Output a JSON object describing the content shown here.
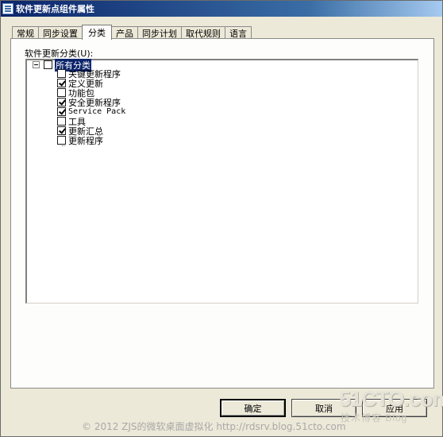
{
  "window": {
    "title": "软件更新点组件属性"
  },
  "tabs": [
    "常规",
    "同步设置",
    "分类",
    "产品",
    "同步计划",
    "取代规则",
    "语言"
  ],
  "active_tab": "分类",
  "group": {
    "label": "软件更新分类(U):"
  },
  "tree": {
    "root": {
      "label": "所有分类",
      "checked": false
    },
    "items": [
      {
        "label": "关键更新程序",
        "checked": false
      },
      {
        "label": "定义更新",
        "checked": true
      },
      {
        "label": "功能包",
        "checked": false
      },
      {
        "label": "安全更新程序",
        "checked": true
      },
      {
        "label": "Service Pack",
        "checked": true
      },
      {
        "label": "工具",
        "checked": false
      },
      {
        "label": "更新汇总",
        "checked": true
      },
      {
        "label": "更新程序",
        "checked": false
      }
    ]
  },
  "buttons": {
    "ok": "确定",
    "cancel": "取消",
    "apply": "应用"
  },
  "watermark": {
    "text": "© 2012 ZJS的微软桌面虚拟化  http://rdsrv.blog.51cto.com",
    "logo": "51CTO.com",
    "logo_sub": "技术博客 Blog"
  }
}
